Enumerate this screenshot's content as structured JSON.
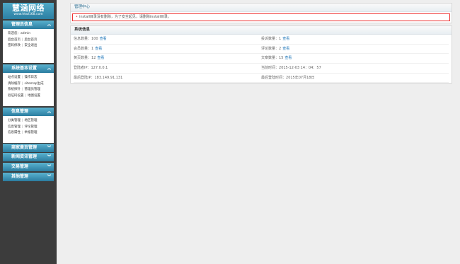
{
  "logo": {
    "title": "慧涵网络",
    "url": "www.htwl168.com"
  },
  "sections": {
    "admin": {
      "title": "管理员信息",
      "rows": [
        [
          "欢迎您：admin"
        ],
        [
          "后台首页",
          "后台首页"
        ],
        [
          "密码修改",
          "安全退出"
        ]
      ]
    },
    "system": {
      "title": "系统基本设置",
      "rows": [
        [
          "站点设置",
          "操作日志"
        ],
        [
          "清除缓存",
          "sitemap生成"
        ],
        [
          "系统探针",
          "管理员管理"
        ],
        [
          "验证码设置",
          "地图设置"
        ]
      ]
    },
    "info": {
      "title": "信息管理",
      "rows": [
        [
          "分类管理",
          "地区管理"
        ],
        [
          "信息管理",
          "评论管理"
        ],
        [
          "信息属性",
          "举报管理"
        ]
      ]
    },
    "merchant": {
      "title": "商家黄页管理"
    },
    "news": {
      "title": "新闻资讯管理"
    },
    "trade": {
      "title": "交易管理"
    },
    "other": {
      "title": "其他管理"
    }
  },
  "main": {
    "header": "管理中心",
    "warning": "install目录没有删除，为了安全起见，请删除install目录。",
    "system_info": {
      "title": "系统信息",
      "view_label": "查看",
      "items": [
        {
          "label": "信息数量：",
          "value": "100",
          "link": true
        },
        {
          "label": "投诉数量：",
          "value": "1",
          "link": true
        },
        {
          "label": "会员数量：",
          "value": "1",
          "link": true
        },
        {
          "label": "评论数量：",
          "value": "2",
          "link": true
        },
        {
          "label": "黄页数量：",
          "value": "12",
          "link": true
        },
        {
          "label": "文章数量：",
          "value": "15",
          "link": true
        },
        {
          "label": "登陆者IP：",
          "value": "127.0.0.1",
          "link": false
        },
        {
          "label": "当前时间：",
          "value": "2015-12-03 14：04：57",
          "link": false
        },
        {
          "label": "最后登陆IP：",
          "value": "183.149.91.131",
          "link": false
        },
        {
          "label": "最后登陆时间：",
          "value": "2015年07月18日",
          "link": false
        }
      ]
    }
  }
}
